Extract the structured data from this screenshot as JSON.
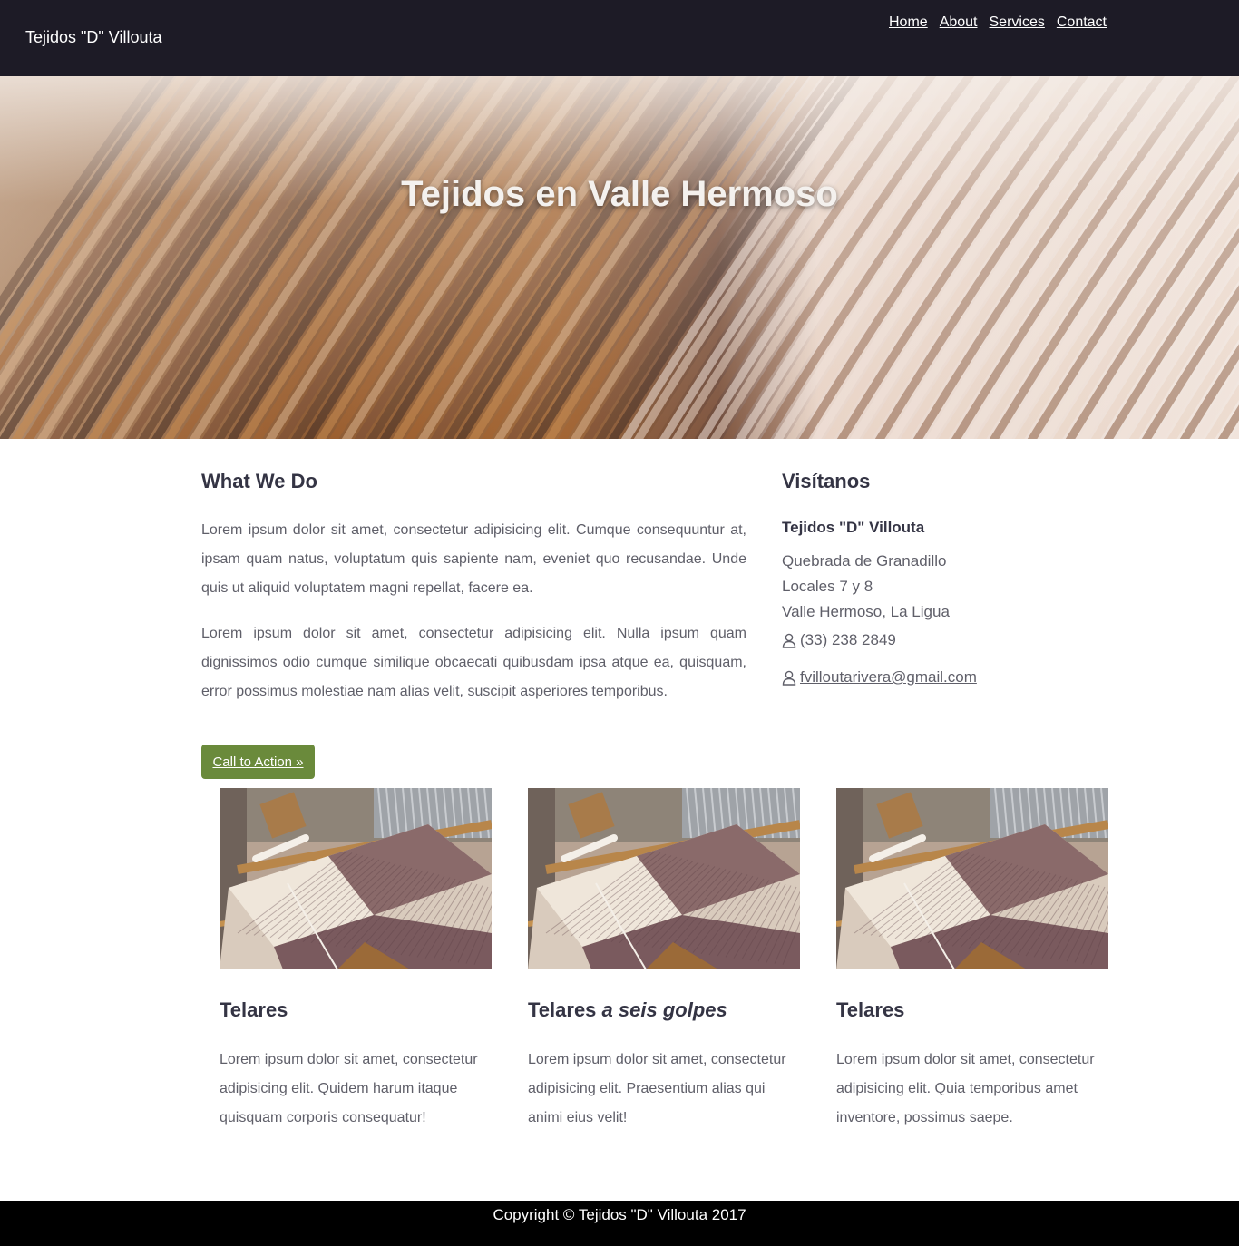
{
  "navbar": {
    "brand": "Tejidos \"D\" Villouta",
    "links": [
      "Home",
      "About",
      "Services",
      "Contact"
    ]
  },
  "hero": {
    "title": "Tejidos en Valle Hermoso"
  },
  "what_we_do": {
    "title": "What We Do",
    "paragraphs": [
      "Lorem ipsum dolor sit amet, consectetur adipisicing elit. Cumque consequuntur at, ipsam quam natus, voluptatum quis sapiente nam, eveniet quo recusandae. Unde quis ut aliquid voluptatem magni repellat, facere ea.",
      "Lorem ipsum dolor sit amet, consectetur adipisicing elit. Nulla ipsum quam dignissimos odio cumque similique obcaecati quibusdam ipsa atque ea, quisquam, error possimus molestiae nam alias velit, suscipit asperiores temporibus."
    ],
    "cta_label": "Call to Action »"
  },
  "visit": {
    "title": "Visítanos",
    "name": "Tejidos \"D\" Villouta",
    "lines": [
      "Quebrada de Granadillo",
      "Locales 7 y 8",
      "Valle Hermoso, La Ligua"
    ],
    "phone": "(33) 238 2849",
    "email": "fvilloutarivera@gmail.com",
    "icon": "user-icon"
  },
  "cards": [
    {
      "title": "Telares",
      "title_em": "",
      "text": "Lorem ipsum dolor sit amet, consectetur adipisicing elit. Quidem harum itaque quisquam corporis consequatur!"
    },
    {
      "title": "Telares ",
      "title_em": "a seis golpes",
      "text": "Lorem ipsum dolor sit amet, consectetur adipisicing elit. Praesentium alias qui animi eius velit!"
    },
    {
      "title": "Telares",
      "title_em": "",
      "text": "Lorem ipsum dolor sit amet, consectetur adipisicing elit. Quia temporibus amet inventore, possimus saepe."
    }
  ],
  "footer": {
    "copyright": "Copyright © Tejidos \"D\" Villouta 2017"
  },
  "colors": {
    "navbar": "#1d1b26",
    "cta": "#6a8a3b",
    "footer": "#000000"
  }
}
